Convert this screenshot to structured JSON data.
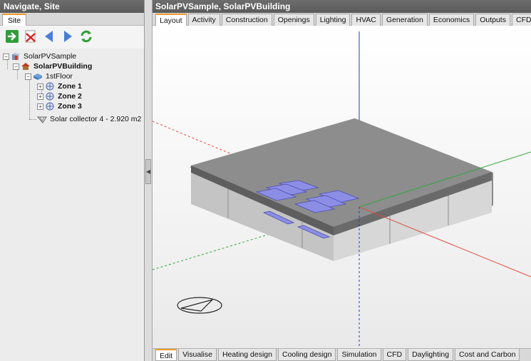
{
  "left_panel": {
    "title": "Navigate, Site",
    "tab": "Site",
    "toolbar": [
      "green-arrow-icon",
      "delete-icon",
      "back-arrow-icon",
      "forward-arrow-icon",
      "refresh-icon"
    ],
    "tree": {
      "site": "SolarPVSample",
      "building": "SolarPVBuilding",
      "floor": "1stFloor",
      "zones": [
        "Zone 1",
        "Zone 2",
        "Zone 3"
      ],
      "collector": "Solar collector 4 - 2.920 m2"
    }
  },
  "right_panel": {
    "title": "SolarPVSample, SolarPVBuilding",
    "top_tabs": [
      "Layout",
      "Activity",
      "Construction",
      "Openings",
      "Lighting",
      "HVAC",
      "Generation",
      "Economics",
      "Outputs",
      "CFD"
    ],
    "active_top_tab": "Layout",
    "bottom_tabs": [
      "Edit",
      "Visualise",
      "Heating design",
      "Cooling design",
      "Simulation",
      "CFD",
      "Daylighting",
      "Cost and Carbon"
    ],
    "active_bottom_tab": "Edit"
  },
  "colors": {
    "accent": "#f19a2c",
    "title_bar": "#5f5f5f",
    "axis_x": "#e04a3a",
    "axis_y": "#2ea83a",
    "axis_z": "#2238c8"
  }
}
